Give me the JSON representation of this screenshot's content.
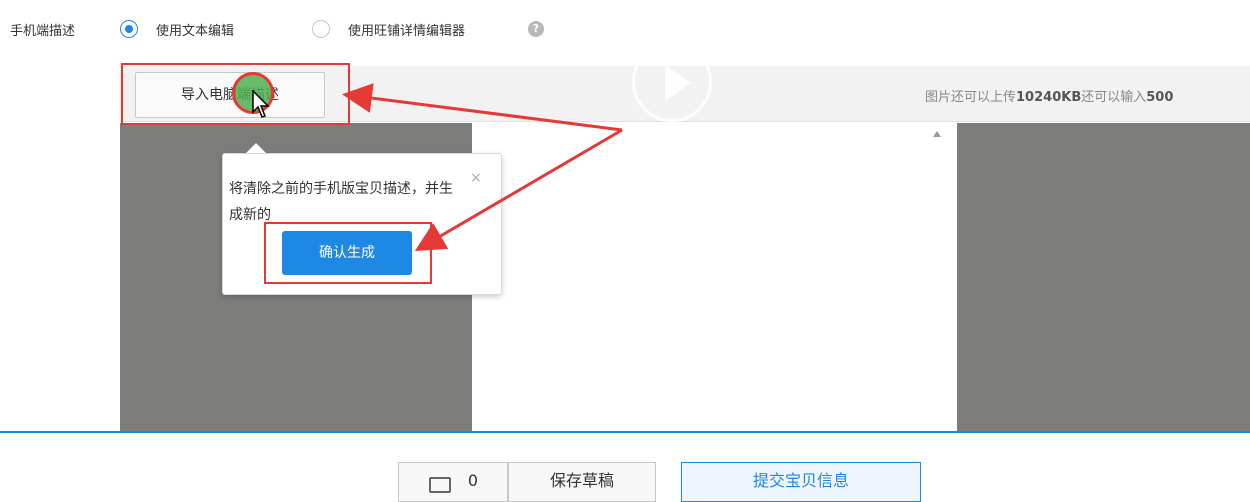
{
  "form": {
    "label": "手机端描述",
    "options": [
      {
        "label": "使用文本编辑",
        "selected": true
      },
      {
        "label": "使用旺铺详情编辑器",
        "selected": false
      }
    ],
    "help_icon": "question-circle-icon"
  },
  "editor": {
    "import_button": "导入电脑端描述",
    "upload_info_prefix": "图片还可以上传",
    "upload_info_size": "10240KB",
    "upload_info_suffix": "还可以输入",
    "upload_info_count": "500"
  },
  "popover": {
    "message": "将清除之前的手机版宝贝描述，并生成新的",
    "close": "×",
    "confirm_button": "确认生成"
  },
  "footer": {
    "save_draft": "保存草稿",
    "submit": "提交宝贝信息",
    "counter": "0"
  },
  "colors": {
    "accent": "#1e88e5",
    "annotation": "#e53935",
    "editor_gray": "#7c7d7b"
  }
}
